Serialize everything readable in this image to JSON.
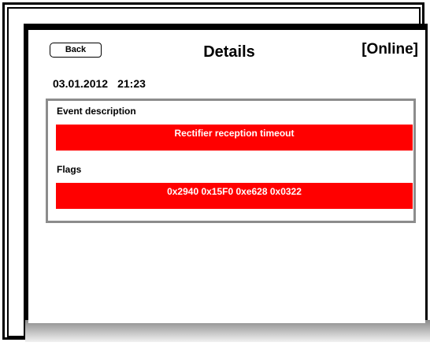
{
  "header": {
    "back_label": "Back",
    "title": "Details",
    "status": "[Online]"
  },
  "timestamp": {
    "date": "03.01.2012",
    "time": "21:23"
  },
  "event": {
    "description_label": "Event description",
    "description_value": "Rectifier reception timeout",
    "flags_label": "Flags",
    "flags_value": "0x2940 0x15F0 0xe628 0x0322"
  },
  "colors": {
    "alert_bar": "#ff0000",
    "box_border": "#8c8c8c"
  }
}
